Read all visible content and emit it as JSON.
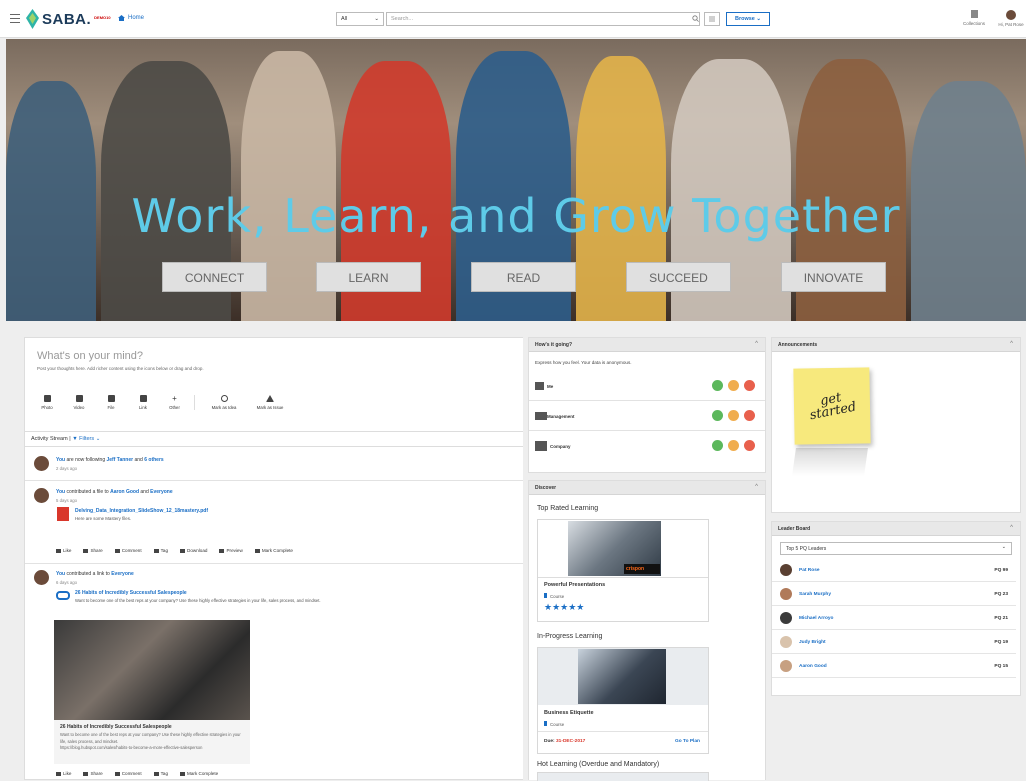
{
  "header": {
    "logo_text": "SABA.",
    "logo_badge": "DEMO10",
    "home": "Home",
    "search_scope": "All",
    "search_placeholder": "Search...",
    "browse": "Browse",
    "collections": "Collections",
    "greeting": "Hi, Pat Rose"
  },
  "hero": {
    "title": "Work, Learn, and Grow Together",
    "buttons": [
      "CONNECT",
      "LEARN",
      "READ",
      "SUCCEED",
      "INNOVATE"
    ]
  },
  "composer": {
    "title": "What's on your mind?",
    "subtitle": "Post your thoughts here. Add richer content using the icons below or drag and drop.",
    "tools": [
      "Photo",
      "Video",
      "File",
      "Link",
      "Other",
      "Mark as Idea",
      "Mark as Issue"
    ]
  },
  "stream": {
    "label": "Activity Stream",
    "filters": "Filters",
    "items": [
      {
        "pre": "You",
        "mid": " are now following ",
        "target": "Jeff Tanner",
        "post": " and ",
        "extra": "6 others",
        "time": "2 days ago"
      },
      {
        "pre": "You",
        "mid": " contributed a file to ",
        "target": "Aaron Good",
        "post": " and ",
        "extra": "Everyone",
        "time": "5 days ago",
        "file": "Delving_Data_Integration_SlideShow_12_18mastery.pdf",
        "file_desc": "Here are some Mastery files."
      },
      {
        "pre": "You",
        "mid": " contributed a link to ",
        "target": "Everyone",
        "time": "6 days ago",
        "link": "26 Habits of Incredibly Successful Salespeople",
        "link_desc": "Want to become one of the best reps at your company? Use these highly effective strategies in your life, sales process, and mindset.",
        "preview_title": "26 Habits of Incredibly Successful Salespeople",
        "preview_desc": "Want to become one of the best reps at your company? Use these highly effective strategies in your life, sales process, and mindset.",
        "preview_url": "https://blog.hubspot.com/sales/habits-to-become-a-more-effective-salesperson"
      }
    ],
    "actions1": [
      "Like",
      "Share",
      "Comment",
      "Tag",
      "Download",
      "Preview",
      "Mark Complete"
    ],
    "actions2": [
      "Like",
      "Share",
      "Comment",
      "Tag",
      "Mark Complete"
    ]
  },
  "mood": {
    "title": "How's it going?",
    "subtitle": "Express how you feel. Your data is anonymous.",
    "rows": [
      "Me",
      "Management",
      "Company"
    ],
    "colors": {
      "good": "#5cb85c",
      "ok": "#f0ad4e",
      "bad": "#e8604c"
    }
  },
  "discover": {
    "title": "Discover",
    "top_rated": "Top Rated Learning",
    "course1": "Powerful Presentations",
    "course_type": "Course",
    "course_tag": "crispon",
    "stars": "★★★★★",
    "in_progress": "In-Progress Learning",
    "course2": "Business Etiquette",
    "due_label": "Due:",
    "due_date": "31-DEC-2017",
    "go_to_plan": "Go To Plan",
    "hot": "Hot Learning (Overdue and Mandatory)"
  },
  "announcements": {
    "title": "Announcements",
    "note": "get started"
  },
  "leaderboard": {
    "title": "Leader Board",
    "select": "Top 5 PQ Leaders",
    "rows": [
      {
        "name": "Pat Rose",
        "pq": "PQ 99"
      },
      {
        "name": "Sarah Murphy",
        "pq": "PQ 23"
      },
      {
        "name": "Michael Arroyo",
        "pq": "PQ 21"
      },
      {
        "name": "Judy Bright",
        "pq": "PQ 19"
      },
      {
        "name": "Aaron Good",
        "pq": "PQ 15"
      }
    ]
  }
}
